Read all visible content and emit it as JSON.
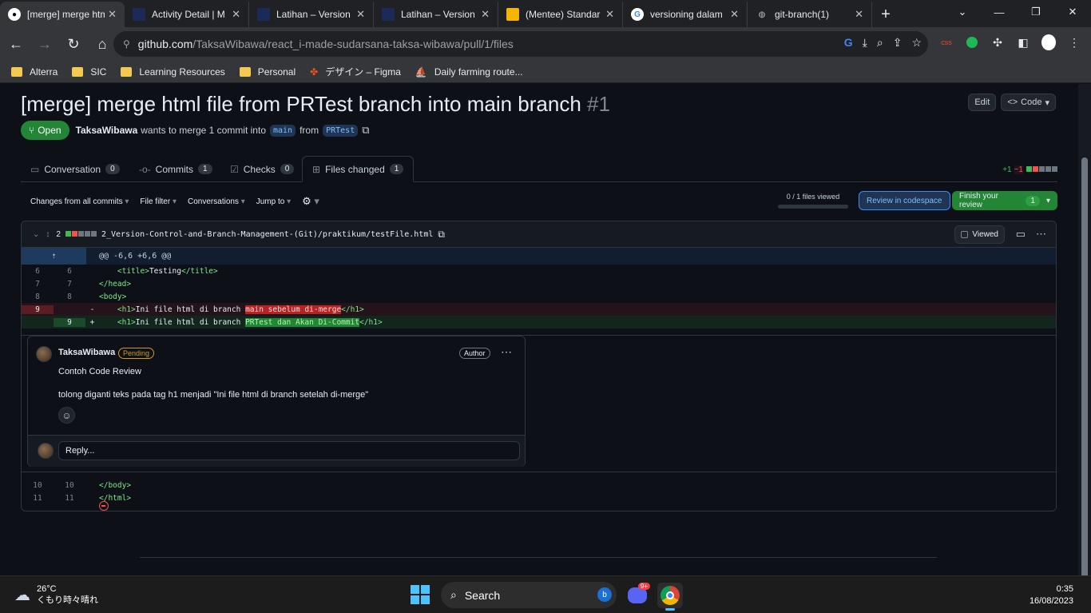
{
  "browser": {
    "tabs": [
      {
        "title": "[merge] merge html",
        "favicon": "github-icon",
        "active": true
      },
      {
        "title": "Activity Detail | M",
        "favicon": "alterra-icon"
      },
      {
        "title": "Latihan – Version",
        "favicon": "alterra-icon"
      },
      {
        "title": "Latihan – Version",
        "favicon": "alterra-icon"
      },
      {
        "title": "(Mentee) Standar",
        "favicon": "slides-icon"
      },
      {
        "title": "versioning dalam",
        "favicon": "google-icon"
      },
      {
        "title": "git-branch(1)",
        "favicon": "globe-icon"
      }
    ],
    "url_host": "github.com",
    "url_path": "/TaksaWibawa/react_i-made-sudarsana-taksa-wibawa/pull/1/files",
    "bookmarks": [
      "Alterra",
      "SIC",
      "Learning Resources",
      "Personal",
      "デザイン – Figma",
      "Daily farming route..."
    ]
  },
  "pr": {
    "title": "[merge] merge html file from PRTest branch into main branch",
    "number": "#1",
    "edit_label": "Edit",
    "code_label": "Code",
    "state": "Open",
    "author": "TaksaWibawa",
    "merge_text": "wants to merge 1 commit into",
    "base_branch": "main",
    "from_text": "from",
    "head_branch": "PRTest"
  },
  "tabs": [
    {
      "label": "Conversation",
      "count": "0"
    },
    {
      "label": "Commits",
      "count": "1"
    },
    {
      "label": "Checks",
      "count": "0"
    },
    {
      "label": "Files changed",
      "count": "1"
    }
  ],
  "diffstat": {
    "additions": "+1",
    "deletions": "−1"
  },
  "toolbar": {
    "changes": "Changes from all commits",
    "file_filter": "File filter",
    "conversations": "Conversations",
    "jump_to": "Jump to",
    "files_viewed": "0 / 1 files viewed",
    "review_codespace": "Review in codespace",
    "finish_review": "Finish your review",
    "finish_count": "1"
  },
  "file": {
    "change_count": "2",
    "path": "2_Version-Control-and-Branch-Management-(Git)/praktikum/testFile.html",
    "viewed_label": "Viewed",
    "hunk": "@@ -6,6 +6,6 @@"
  },
  "diff_lines": {
    "l6": {
      "old": "6",
      "new": "6"
    },
    "l7": {
      "old": "7",
      "new": "7"
    },
    "l8": {
      "old": "8",
      "new": "8"
    },
    "del": {
      "old": "9",
      "sign": "-",
      "pre": "Ini file html di branch ",
      "hl": "main sebelum di-merge"
    },
    "ins": {
      "new": "9",
      "sign": "+",
      "pre": "Ini file html di branch ",
      "hl": "PRTest dan Akan Di-Commit"
    },
    "l10": {
      "old": "10",
      "new": "10"
    },
    "l11": {
      "old": "11",
      "new": "11"
    },
    "code": {
      "title_open": "<title>",
      "title_text": "Testing",
      "title_close": "</title>",
      "head_close": "</head>",
      "body_open": "<body>",
      "h1_open": "<h1>",
      "h1_close": "</h1>",
      "body_close": "</body>",
      "html_close": "</html>"
    }
  },
  "comment": {
    "user": "TaksaWibawa",
    "pending": "Pending",
    "author_badge": "Author",
    "title": "Contoh Code Review",
    "body": "tolong diganti teks pada tag h1 menjadi \"Ini file html di branch setelah di-merge\"",
    "reply_placeholder": "Reply..."
  },
  "taskbar": {
    "temperature": "26°C",
    "weather": "くもり時々晴れ",
    "search": "Search",
    "discord_badge": "9+",
    "time": "0:35",
    "date": "16/08/2023"
  },
  "colors": {
    "accent_green": "#238636",
    "accent_blue": "#388bfd",
    "deletion": "#f85149",
    "addition": "#3fb950"
  }
}
